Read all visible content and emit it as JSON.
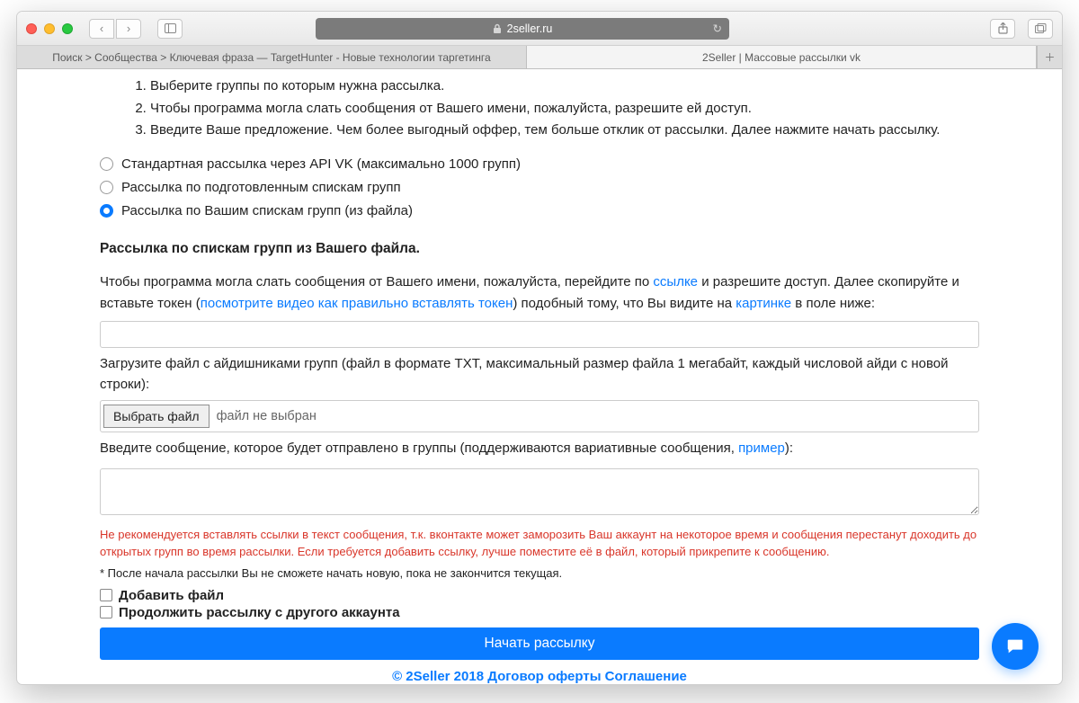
{
  "browser": {
    "url_host": "2seller.ru",
    "tabs": [
      "Поиск > Сообщества > Ключевая фраза — TargetHunter - Новые технологии таргетинга",
      "2Seller | Массовые рассылки vk"
    ]
  },
  "instructions": [
    "Выберите группы по которым нужна рассылка.",
    "Чтобы программа могла слать сообщения от Вашего имени, пожалуйста, разрешите ей доступ.",
    "Введите Ваше предложение. Чем более выгодный оффер, тем больше отклик от рассылки. Далее нажмите начать рассылку."
  ],
  "radios": {
    "opt1": "Стандартная рассылка через API VK (максимально 1000 групп)",
    "opt2": "Рассылка по подготовленным спискам групп",
    "opt3": "Рассылка по Вашим спискам групп (из файла)",
    "selected": 3
  },
  "section_title": "Рассылка по спискам групп из Вашего файла.",
  "token_intro": {
    "a": "Чтобы программа могла слать сообщения от Вашего имени, пожалуйста, перейдите по ",
    "link1": "ссылке",
    "b": " и разрешите доступ. Далее скопируйте и вставьте токен (",
    "link2": "посмотрите видео как правильно вставлять токен",
    "c": ") подобный тому, что Вы видите на ",
    "link3": "картинке",
    "d": " в поле ниже:"
  },
  "upload_label": "Загрузите файл с айдишниками групп (файл в формате TXT, максимальный размер файла 1 мегабайт, каждый числовой айди с новой строки):",
  "file_button": "Выбрать файл",
  "file_status": "файл не выбран",
  "message_label": {
    "a": "Введите сообщение, которое будет отправлено в группы (поддерживаются вариативные сообщения, ",
    "link": "пример",
    "b": "):"
  },
  "warning": "Не рекомендуется вставлять ссылки в текст сообщения, т.к. вконтакте может заморозить Ваш аккаунт на некоторое время и сообщения перестанут доходить до открытых групп во время рассылки. Если требуется добавить ссылку, лучше поместите её в файл, который прикрепите к сообщению.",
  "star_note": "* После начала рассылки Вы не сможете начать новую, пока не закончится текущая.",
  "check1": "Добавить файл",
  "check2": "Продолжить рассылку с другого аккаунта",
  "start_button": "Начать рассылку",
  "footer": "© 2Seller 2018 Договор оферты Соглашение"
}
